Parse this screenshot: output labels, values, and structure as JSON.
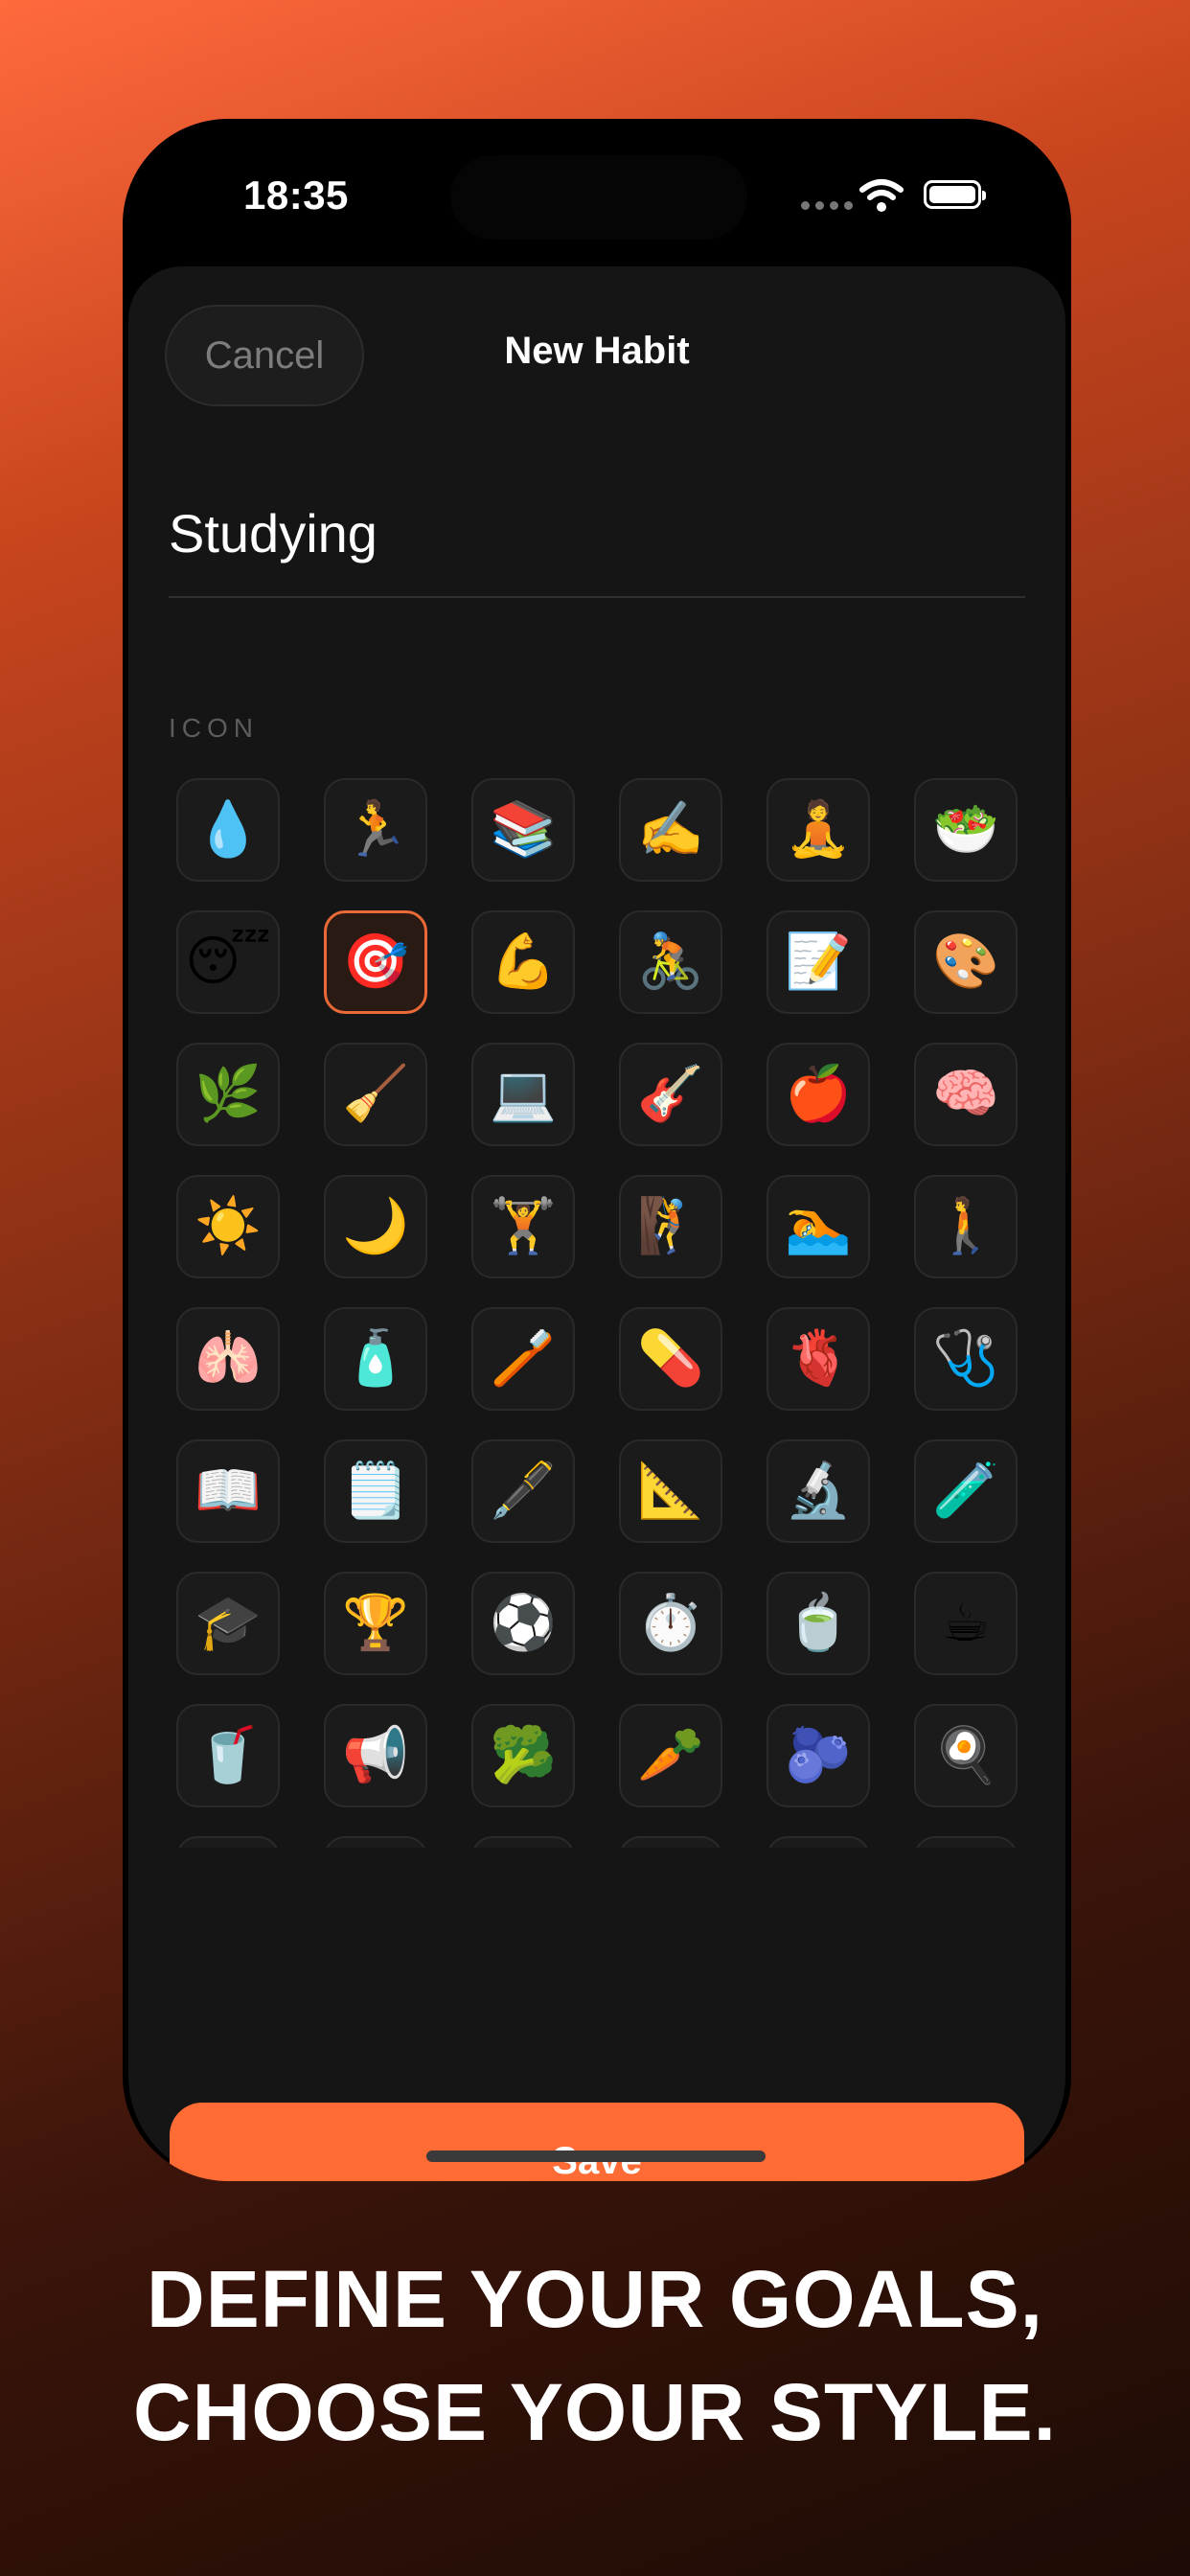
{
  "status_bar": {
    "time": "18:35"
  },
  "header": {
    "cancel_label": "Cancel",
    "title": "New Habit"
  },
  "habit_name": {
    "value": "Studying"
  },
  "icon_section": {
    "label": "ICON",
    "icons": [
      [
        "💧",
        "🏃",
        "📚",
        "✍️",
        "🧘",
        "🥗"
      ],
      [
        "😴",
        "🎯",
        "💪",
        "🚴",
        "📝",
        "🎨"
      ],
      [
        "🌿",
        "🧹",
        "💻",
        "🎸",
        "🍎",
        "🧠"
      ],
      [
        "☀️",
        "🌙",
        "🏋️",
        "🧗",
        "🏊",
        "🚶"
      ],
      [
        "🫁",
        "🧴",
        "🪥",
        "💊",
        "🫀",
        "🩺"
      ],
      [
        "📖",
        "🗒️",
        "🖋️",
        "📐",
        "🔬",
        "🧪"
      ],
      [
        "🎓",
        "🏆",
        "⚽",
        "⏱️",
        "🍵",
        "☕"
      ],
      [
        "🥤",
        "📢",
        "🥦",
        "🥕",
        "🫐",
        "🍳"
      ]
    ],
    "selected": {
      "row": 1,
      "col": 1
    }
  },
  "save_label": "Save",
  "tagline": {
    "line1": "DEFINE YOUR GOALS,",
    "line2": "CHOOSE YOUR STYLE."
  },
  "colors": {
    "accent": "#ff6b35",
    "sheet_bg": "#151515",
    "tile_bg": "#1b1b1b"
  }
}
